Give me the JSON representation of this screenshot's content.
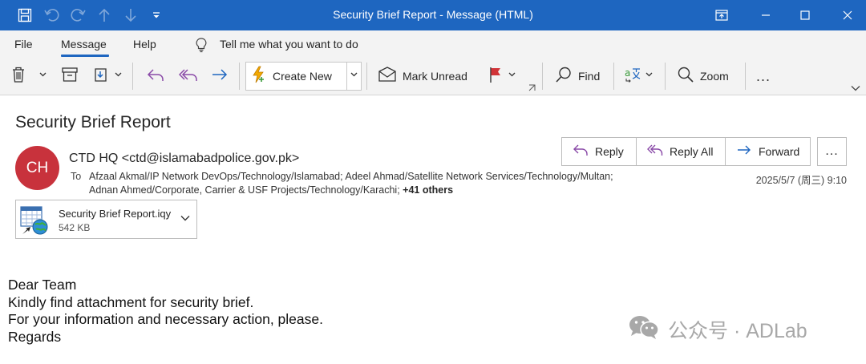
{
  "window": {
    "title": "Security Brief Report  -  Message (HTML)",
    "title_bar_color": "#1e66c0"
  },
  "menu": {
    "tabs": [
      {
        "label": "File"
      },
      {
        "label": "Message",
        "active": true
      },
      {
        "label": "Help"
      }
    ],
    "tell_me": "Tell me what you want to do"
  },
  "ribbon": {
    "create_new": "Create New",
    "mark_unread": "Mark Unread",
    "find": "Find",
    "zoom": "Zoom",
    "more": "..."
  },
  "message": {
    "subject": "Security Brief Report",
    "avatar_initials": "CH",
    "avatar_color": "#c8323c",
    "sender": "CTD HQ <ctd@islamabadpolice.gov.pk>",
    "to_label": "To",
    "recipients_line1": "Afzaal Akmal/IP Network DevOps/Technology/Islamabad; Adeel Ahmad/Satellite Network Services/Technology/Multan;",
    "recipients_line2": "Adnan Ahmed/Corporate, Carrier & USF Projects/Technology/Karachi; ",
    "others": "+41 others",
    "date": "2025/5/7 (周三) 9:10",
    "actions": {
      "reply": "Reply",
      "reply_all": "Reply All",
      "forward": "Forward",
      "more": "..."
    },
    "attachment": {
      "name": "Security Brief Report.iqy",
      "size": "542 KB"
    },
    "body": {
      "line1": "Dear Team",
      "line2": "Kindly find attachment for security brief.",
      "line3": "For your information and necessary action, please.",
      "line4": "Regards"
    }
  },
  "watermark": {
    "text": "公众号 · ADLab"
  }
}
